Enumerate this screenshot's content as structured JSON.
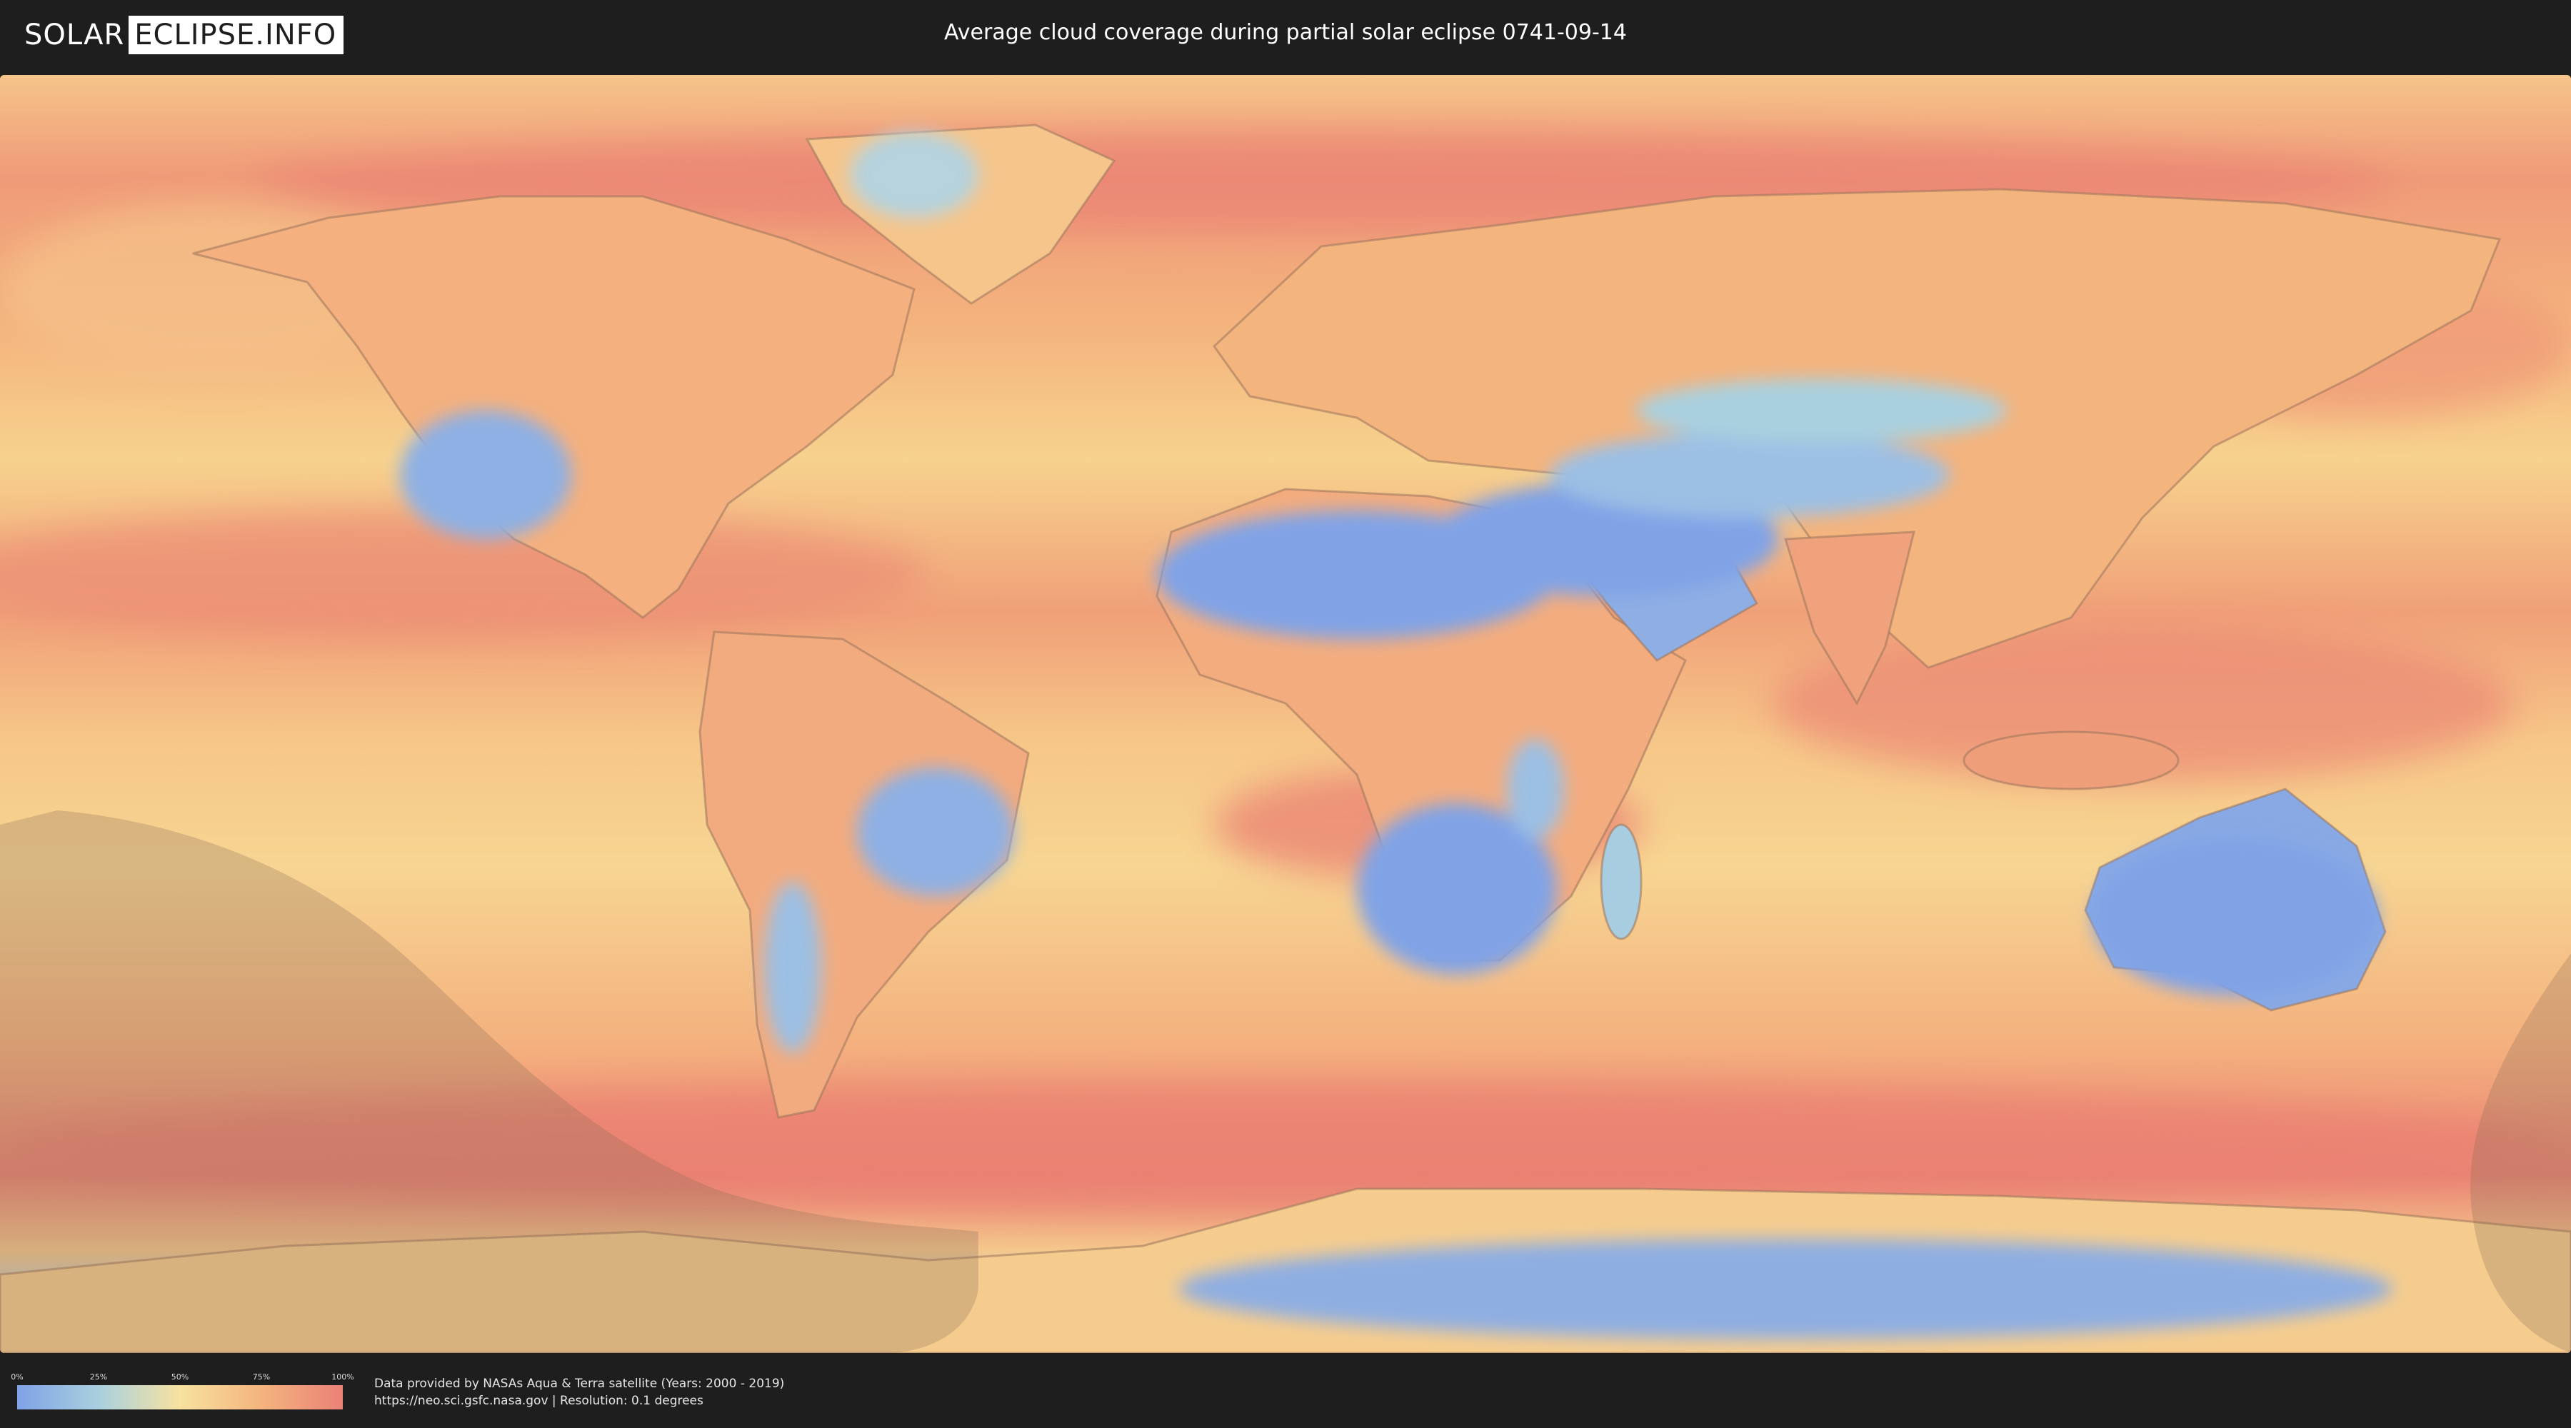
{
  "header": {
    "logo_left": "SOLAR",
    "logo_right": "ECLIPSE.INFO",
    "title": "Average cloud coverage during partial solar eclipse 0741-09-14"
  },
  "legend": {
    "ticks": [
      "0%",
      "25%",
      "50%",
      "75%",
      "100%"
    ],
    "colors": [
      "#7fa2e6",
      "#a9d0df",
      "#f7e2a0",
      "#f4b47e",
      "#ea8177"
    ]
  },
  "footer": {
    "credit_line1": "Data provided by NASAs Aqua & Terra satellite (Years: 2000 - 2019)",
    "credit_line2": "https://neo.sci.gsfc.nasa.gov | Resolution: 0.1 degrees"
  },
  "map": {
    "palette": {
      "ocean_cloudy": "#ea8a74",
      "ocean_mid": "#f4b27c",
      "clear_land": "#7fa2e6",
      "partly_clear": "#a9cfe0",
      "coast": "#8a6b55",
      "eclipse_shade": "#8a6a55"
    }
  }
}
